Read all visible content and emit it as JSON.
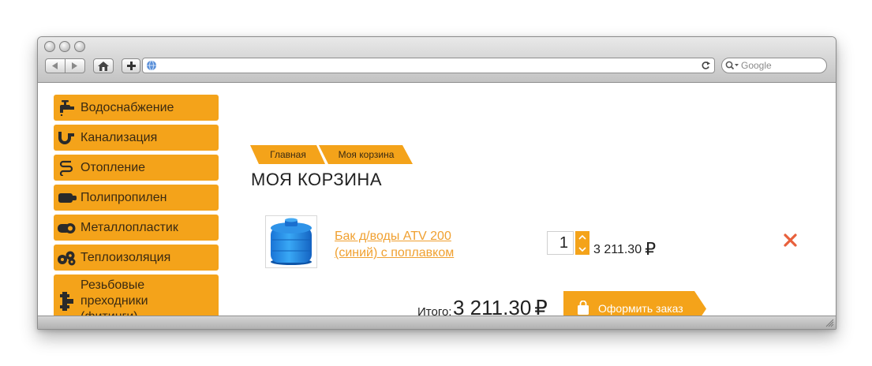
{
  "browser": {
    "search_placeholder": "Google"
  },
  "sidebar": {
    "items": [
      {
        "label": "Водоснабжение",
        "icon": "faucet-icon"
      },
      {
        "label": "Канализация",
        "icon": "pipe-trap-icon"
      },
      {
        "label": "Отопление",
        "icon": "heating-coil-icon"
      },
      {
        "label": "Полипропилен",
        "icon": "pipe-icon"
      },
      {
        "label": "Металлопластик",
        "icon": "pipe-coil-icon"
      },
      {
        "label": "Теплоизоляция",
        "icon": "insulation-icon"
      },
      {
        "label": "Резьбовые преходники (фитинги)",
        "icon": "fitting-icon"
      }
    ]
  },
  "breadcrumb": {
    "items": [
      "Главная",
      "Моя корзина"
    ]
  },
  "page": {
    "title": "МОЯ КОРЗИНА"
  },
  "cart": {
    "item": {
      "name": "Бак д/воды ATV 200 (синий) с поплавком",
      "quantity": "1",
      "price": "3 211.30",
      "currency": "₽"
    },
    "total_label": "Итого:",
    "total_value": "3 211.30",
    "checkout_label": "Оформить заказ"
  },
  "colors": {
    "accent": "#f4a31a",
    "link": "#f0a030",
    "delete": "#e8603c"
  }
}
